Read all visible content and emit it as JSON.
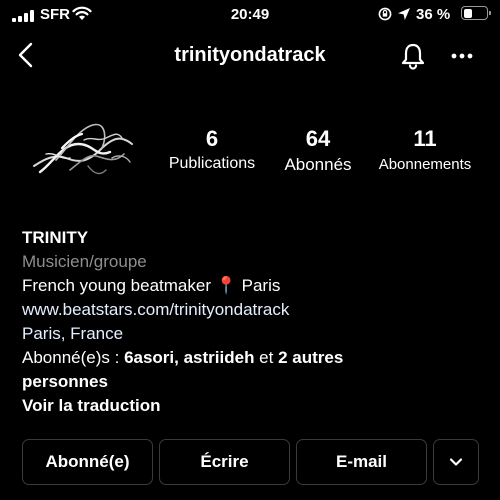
{
  "status_bar": {
    "carrier": "SFR",
    "time": "20:49",
    "battery_percent": "36 %",
    "battery_level": 0.36,
    "icons": [
      "signal-icon",
      "wifi-icon",
      "rotation-lock-icon",
      "location-icon",
      "battery-icon"
    ]
  },
  "header": {
    "username": "trinityondatrack",
    "icons": [
      "back-chevron-icon",
      "bell-icon",
      "more-dots-icon"
    ]
  },
  "stats": {
    "publications": {
      "value": "6",
      "label": "Publications"
    },
    "followers": {
      "value": "64",
      "label": "Abonnés"
    },
    "following": {
      "value": "11",
      "label": "Abonnements"
    }
  },
  "bio": {
    "name": "TRINITY",
    "category": "Musicien/groupe",
    "description_prefix": "French young beatmaker",
    "description_pin": "📍",
    "description_suffix": "Paris",
    "link": "www.beatstars.com/trinityondatrack",
    "location": "Paris, France",
    "followed_by_prefix": "Abonné(e)s : ",
    "followed_by_users": "6asori, astriideh",
    "followed_by_and": " et ",
    "followed_by_others_line1": "2 autres",
    "followed_by_others_line2": "personnes",
    "translate": "Voir la traduction"
  },
  "actions": {
    "following_label": "Abonné(e)",
    "message_label": "Écrire",
    "email_label": "E-mail"
  },
  "colors": {
    "background": "#000000",
    "text": "#ffffff",
    "muted": "#8e8e8e",
    "button_border": "#3a3a3a"
  }
}
